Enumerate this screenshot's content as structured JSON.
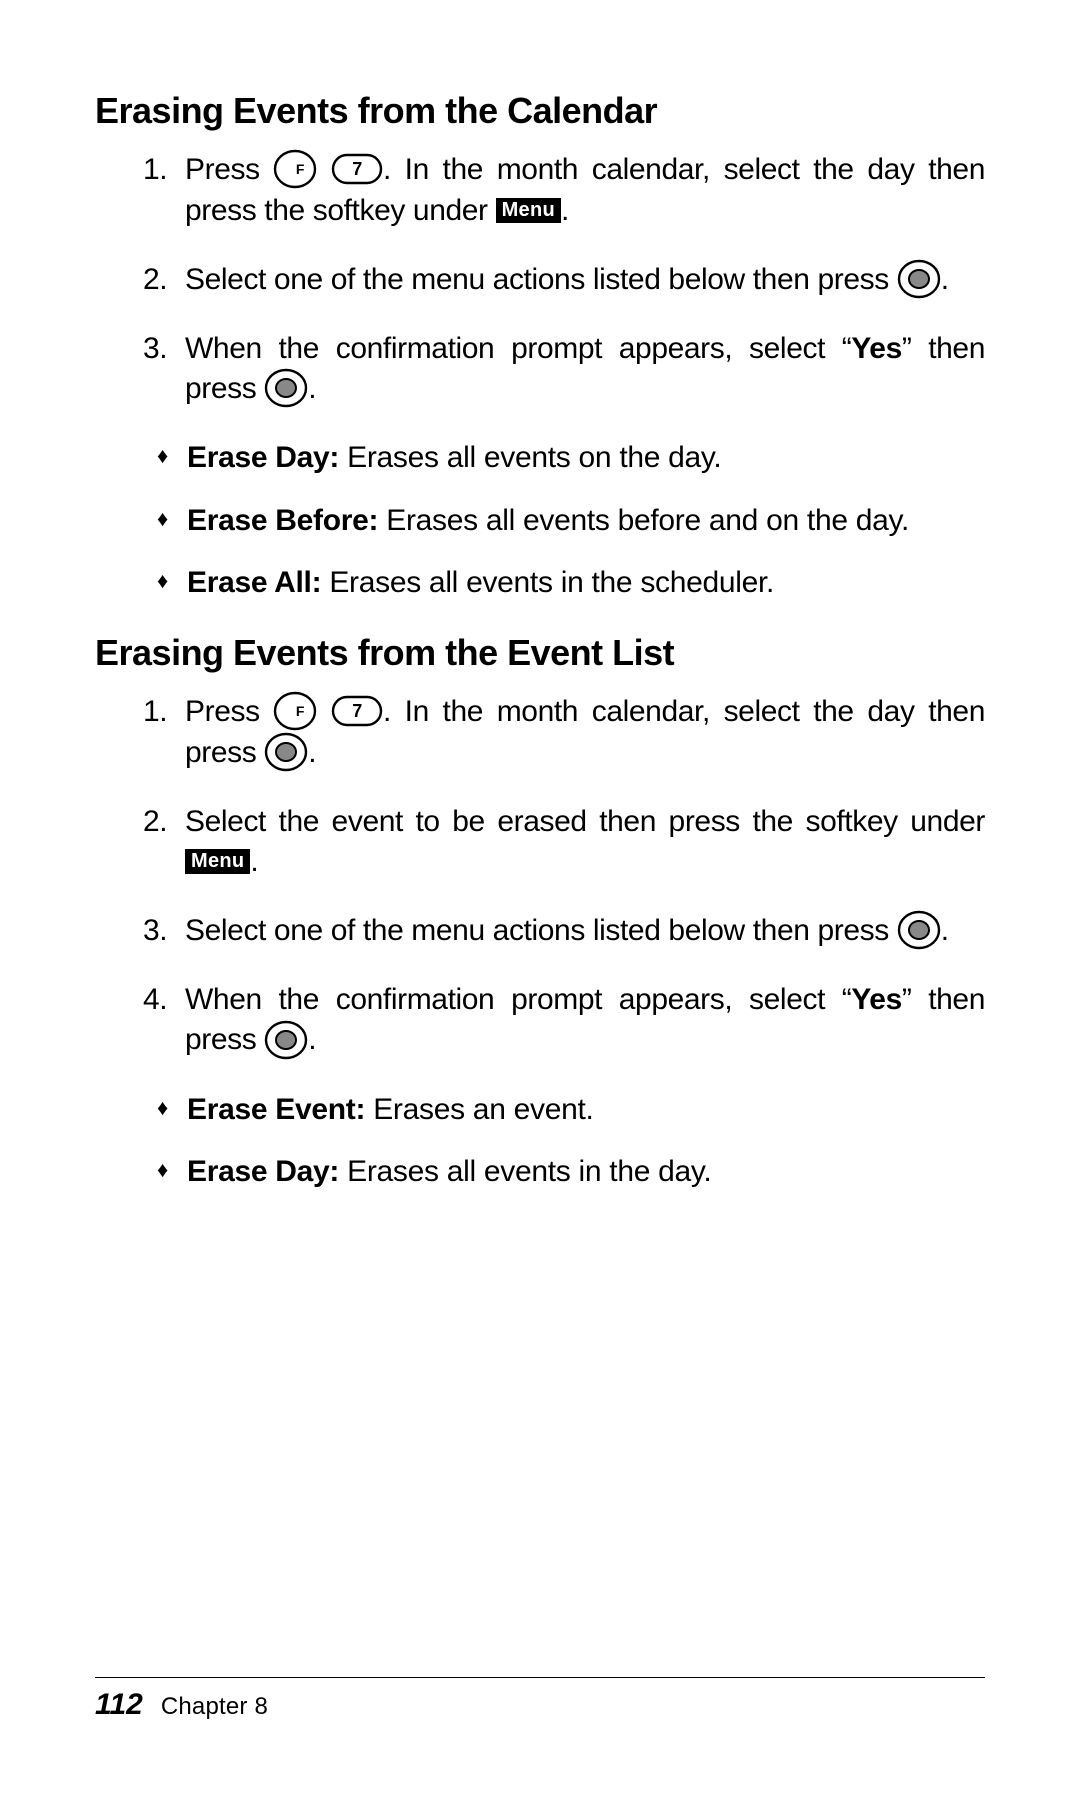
{
  "section1": {
    "heading": "Erasing Events from the Calendar",
    "steps": {
      "s1a": "Press ",
      "s1b": ". In the month calendar, select the day then press the softkey under ",
      "s1c": ".",
      "s2a": "Select one of the menu actions listed below then press ",
      "s2b": ".",
      "s3a": "When the confirmation prompt appears, select “",
      "s3yes": "Yes",
      "s3b": "” then press ",
      "s3c": "."
    },
    "bullets": {
      "b1_term": "Erase Day: ",
      "b1_desc": "Erases all events on the day.",
      "b2_term": "Erase Before: ",
      "b2_desc": "Erases all events before and on the day.",
      "b3_term": "Erase All: ",
      "b3_desc": "Erases all events in the scheduler."
    }
  },
  "section2": {
    "heading": "Erasing Events from the Event List",
    "steps": {
      "s1a": "Press ",
      "s1b": ". In the month calendar, select the day then press ",
      "s1c": ".",
      "s2a": "Select the event to be erased then press the softkey under ",
      "s2b": ".",
      "s3a": "Select one of the menu actions listed below then press ",
      "s3b": ".",
      "s4a": "When the confirmation prompt appears, select “",
      "s4yes": "Yes",
      "s4b": "” then press ",
      "s4c": "."
    },
    "bullets": {
      "b1_term": "Erase Event: ",
      "b1_desc": "Erases an event.",
      "b2_term": "Erase Day: ",
      "b2_desc": "Erases all events in the day."
    }
  },
  "icons": {
    "fkey_label": "F",
    "sevenkey_label": "7",
    "menu_label": "Menu"
  },
  "footer": {
    "page": "112",
    "chapter": "Chapter 8"
  }
}
